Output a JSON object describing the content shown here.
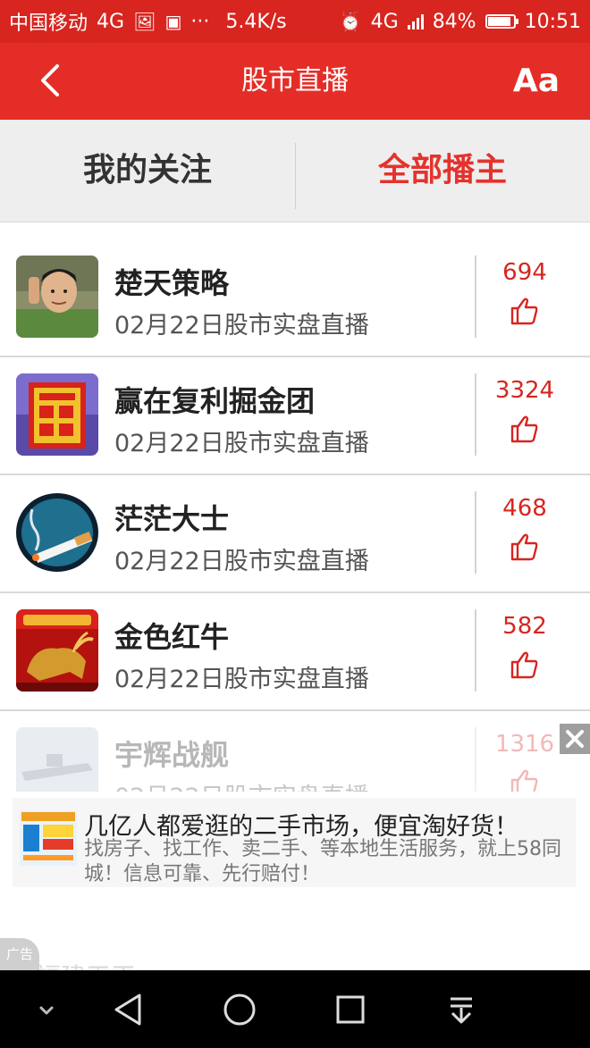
{
  "status_bar": {
    "carrier": "中国移动",
    "network": "4G",
    "more": "···",
    "speed": "5.4K/s",
    "network2": "4G",
    "battery": "84%",
    "battery_level": 0.84,
    "time": "10:51"
  },
  "header": {
    "title": "股市直播",
    "font_button": "Aa",
    "accent": "#e52d27"
  },
  "tabs": [
    {
      "label": "我的关注",
      "active": false
    },
    {
      "label": "全部播主",
      "active": true
    }
  ],
  "broadcasters": [
    {
      "name": "楚天策略",
      "subtitle": "02月22日股市实盘直播",
      "likes": "694",
      "avatar": "man-photo-avatar"
    },
    {
      "name": "赢在复利掘金团",
      "subtitle": "02月22日股市实盘直播",
      "likes": "3324",
      "avatar": "ying-character-avatar"
    },
    {
      "name": "茫茫大士",
      "subtitle": "02月22日股市实盘直播",
      "likes": "468",
      "avatar": "cigarette-avatar"
    },
    {
      "name": "金色红牛",
      "subtitle": "02月22日股市实盘直播",
      "likes": "582",
      "avatar": "golden-bull-avatar"
    },
    {
      "name": "宇辉战舰",
      "subtitle": "02月22日股市实盘直播",
      "likes": "1316",
      "avatar": "warship-avatar"
    }
  ],
  "ad": {
    "title": "几亿人都爱逛的二手市场，便宜淘好货！",
    "description": "找房子、找工作、卖二手、等本地生活服务，就上58同城！信息可靠、先行赔付！",
    "tag": "广告"
  },
  "peek_row": {
    "name": "福建天王"
  }
}
